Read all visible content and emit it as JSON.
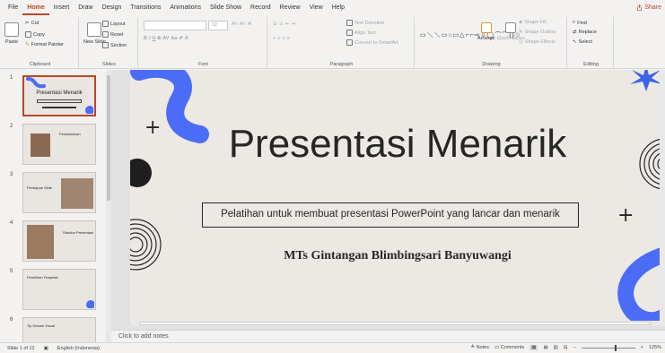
{
  "menu": {
    "tabs": [
      "File",
      "Home",
      "Insert",
      "Draw",
      "Design",
      "Transitions",
      "Animations",
      "Slide Show",
      "Record",
      "Review",
      "View",
      "Help"
    ],
    "active_tab": "Home",
    "share_label": "Share"
  },
  "ribbon": {
    "clipboard": {
      "label": "Clipboard",
      "paste": "Paste",
      "cut": "Cut",
      "copy": "Copy",
      "format_painter": "Format Painter"
    },
    "slides": {
      "label": "Slides",
      "new_slide": "New Slide",
      "layout": "Layout",
      "reset": "Reset",
      "section": "Section"
    },
    "font": {
      "label": "Font",
      "size_value": "32"
    },
    "paragraph": {
      "label": "Paragraph",
      "text_direction": "Text Direction",
      "align_text": "Align Text",
      "convert_smartart": "Convert to SmartArt"
    },
    "drawing": {
      "label": "Drawing",
      "arrange": "Arrange",
      "quick_styles": "Quick Styles",
      "shape_fill": "Shape Fill",
      "shape_outline": "Shape Outline",
      "shape_effects": "Shape Effects"
    },
    "editing": {
      "label": "Editing",
      "find": "Find",
      "replace": "Replace",
      "select": "Select"
    }
  },
  "thumbnails": [
    {
      "number": "1",
      "title": "Presentasi Menarik",
      "active": true
    },
    {
      "number": "2",
      "title": "Pendahuluan",
      "active": false
    },
    {
      "number": "3",
      "title": "Persiapan Slide",
      "active": false
    },
    {
      "number": "4",
      "title": "Struktur Presentasi",
      "active": false
    },
    {
      "number": "5",
      "title": "Pemilihan Template",
      "active": false
    },
    {
      "number": "6",
      "title": "Tip Desain Visual",
      "active": false
    }
  ],
  "slide": {
    "title": "Presentasi Menarik",
    "subtitle": "Pelatihan untuk membuat presentasi PowerPoint yang lancar dan menarik",
    "school": "MTs Gintangan Blimbingsari Banyuwangi"
  },
  "notes_placeholder": "Click to add notes",
  "status": {
    "slide_counter": "Slide 1 of 12",
    "language": "English (Indonesia)",
    "notes": "Notes",
    "comments": "Comments",
    "zoom": "125%",
    "zoom_fraction": 0.62
  },
  "colors": {
    "accent": "#b7472a",
    "blue_shape": "#4a6cf7"
  }
}
